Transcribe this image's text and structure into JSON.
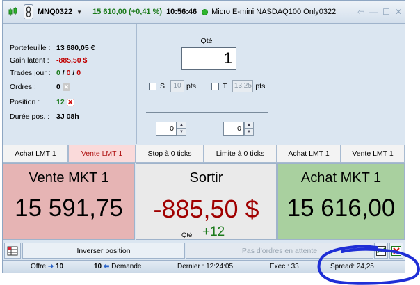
{
  "titlebar": {
    "symbol": "MNQ0322",
    "price": "15 610,00 (+0,41 %)",
    "time": "10:56:46",
    "description": "Micro E-mini NASDAQ100 Only0322"
  },
  "info": {
    "portefeuille_label": "Portefeuille :",
    "portefeuille_value": "13 680,05 €",
    "gain_label": "Gain latent :",
    "gain_value": "-885,50 $",
    "trades_label": "Trades jour :",
    "trades_a": "0",
    "trades_sep1": " / ",
    "trades_b": "0",
    "trades_sep2": " / ",
    "trades_c": "0",
    "ordres_label": "Ordres :",
    "ordres_value": "0",
    "position_label": "Position :",
    "position_value": "12",
    "duree_label": "Durée pos. :",
    "duree_value": "3J 08h"
  },
  "qty": {
    "label": "Qté",
    "value": "1",
    "stop_label": "S",
    "stop_pts": "10",
    "pts_label": "pts",
    "target_label": "T",
    "target_pts": "13.25",
    "spin_left": "0",
    "spin_right": "0"
  },
  "order_buttons": {
    "achat_lmt_left": "Achat LMT 1",
    "vente_lmt_left": "Vente LMT 1",
    "stop_ticks": "Stop à 0 ticks",
    "limite_ticks": "Limite à 0 ticks",
    "achat_lmt_right": "Achat LMT 1",
    "vente_lmt_right": "Vente LMT 1"
  },
  "sell_panel": {
    "title": "Vente MKT 1",
    "price": "15 591,75"
  },
  "exit_panel": {
    "title": "Sortir",
    "pnl": "-885,50 $",
    "qte_label": "Qté",
    "qte_value": "+12"
  },
  "buy_panel": {
    "title": "Achat MKT 1",
    "price": "15 616,00"
  },
  "toolbar": {
    "reverse_label": "Inverser position",
    "pending_label": "Pas d'ordres en attente"
  },
  "status": {
    "offre_label": "Offre",
    "offre_value": "10",
    "demande_value": "10",
    "demande_label": "Demande",
    "dernier": "Dernier : 12:24:05",
    "exec": "Exec : 33",
    "spread": "Spread:  24,25"
  },
  "colors": {
    "sell_bg": "#e6b4b4",
    "buy_bg": "#a9d09f",
    "exit_text": "#a00000",
    "positive": "#1a7a1a",
    "highlight": "#1f2fd6"
  }
}
